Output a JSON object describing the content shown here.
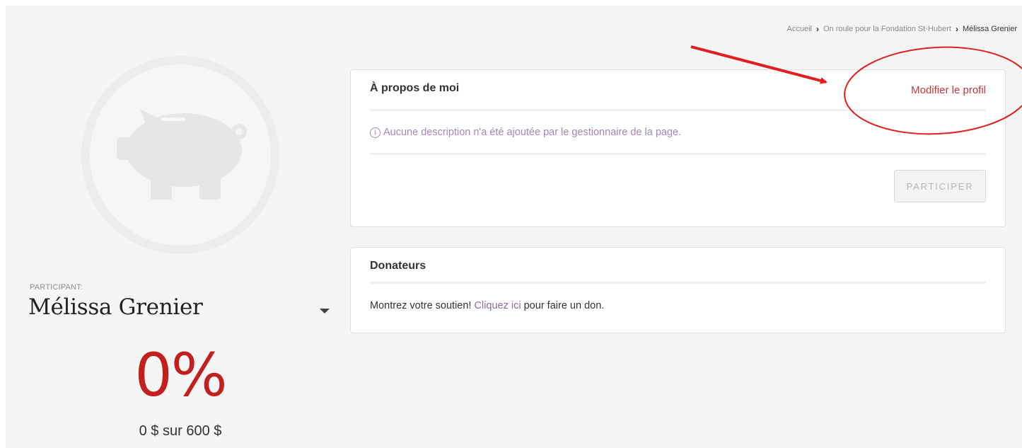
{
  "breadcrumb": {
    "items": [
      "Accueil",
      "On roule pour la Fondation St-Hubert",
      "Mélissa Grenier"
    ]
  },
  "profile": {
    "label": "PARTICIPANT:",
    "name": "Mélissa Grenier",
    "progress_text": "0%",
    "progress_fraction": 0,
    "amount_text": "0 $ sur 600 $",
    "avatar_icon": "piggy-bank-icon"
  },
  "about": {
    "title": "À propos de moi",
    "edit_label": "Modifier le profil",
    "info_icon": "info-icon",
    "info_text": "Aucune description n'a été ajoutée par le gestionnaire de la page.",
    "participate_label": "PARTICIPER"
  },
  "donors": {
    "title": "Donateurs",
    "text_before": "Montrez votre soutien! ",
    "link_label": "Cliquez ici",
    "text_after": " pour faire un don."
  },
  "colors": {
    "accent_red": "#c41f1f",
    "annotation_red": "#e31e1e",
    "info_purple": "#a985b8",
    "background": "#f4f5f5"
  }
}
